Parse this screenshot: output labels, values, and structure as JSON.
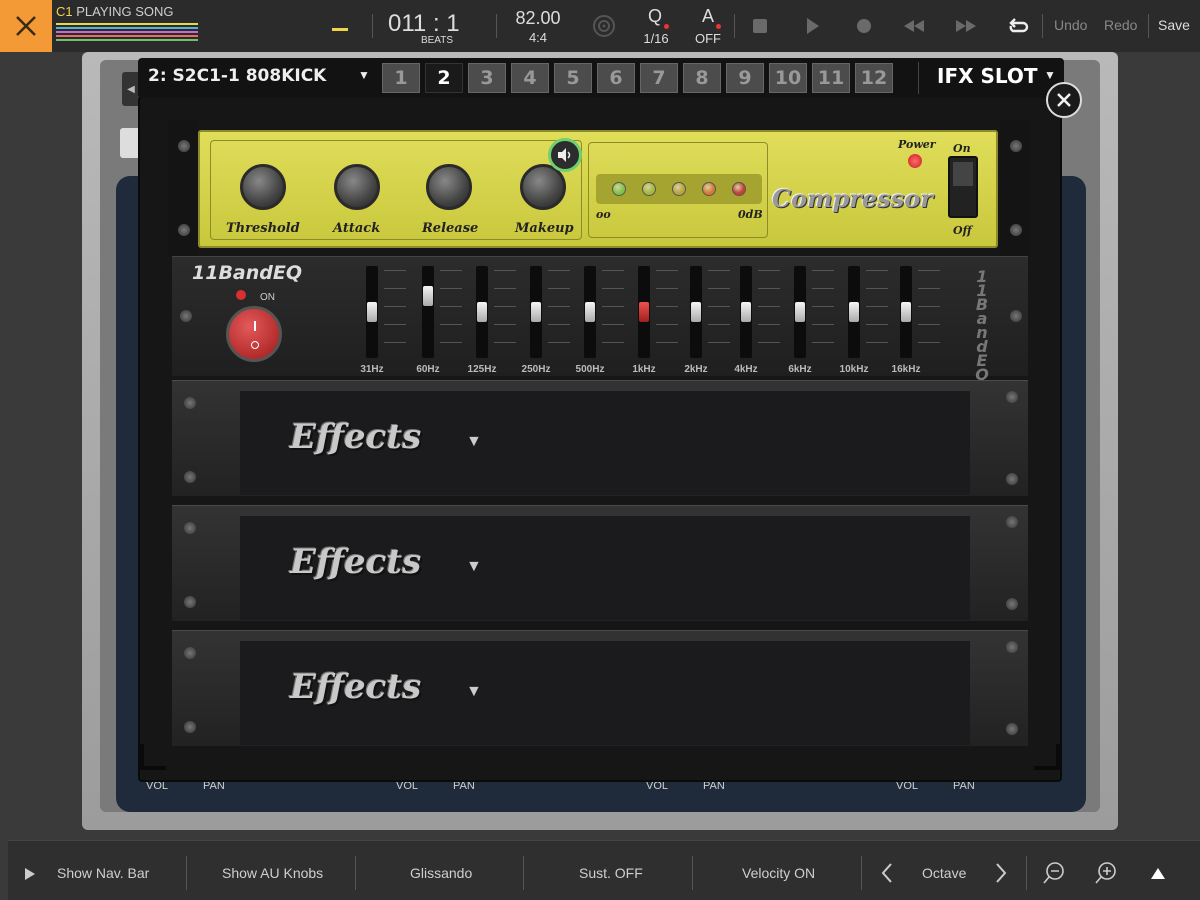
{
  "topbar": {
    "song_slot": "C1",
    "song_status": "PLAYING SONG",
    "position_bar": "011",
    "position_sep": ":",
    "position_beat": "1",
    "position_unit": "BEATS",
    "tempo": "82.00",
    "time_signature": "4:4",
    "quantize_label": "Q",
    "quantize_value": "1/16",
    "automation_label": "A",
    "automation_value": "OFF",
    "undo_label": "Undo",
    "redo_label": "Redo",
    "save_label": "Save",
    "track_colors": [
      "#e8d848",
      "#4fb4d6",
      "#c86ad0",
      "#e86b6b",
      "#74c06a"
    ]
  },
  "plugin": {
    "track_name": "2: S2C1-1 808KICK",
    "slots": [
      "1",
      "2",
      "3",
      "4",
      "5",
      "6",
      "7",
      "8",
      "9",
      "10",
      "11",
      "12"
    ],
    "active_slot": "2",
    "slot_type": "IFX SLOT"
  },
  "compressor": {
    "title": "Compressor",
    "knobs": [
      "Threshold",
      "Attack",
      "Release",
      "Makeup"
    ],
    "meter_min": "oo",
    "meter_max": "0dB",
    "power_label": "Power",
    "switch_on": "On",
    "switch_off": "Off",
    "led_colors": [
      "#7fc34a",
      "#a5b840",
      "#b8a440",
      "#d6783a",
      "#c8403a"
    ]
  },
  "eq": {
    "title": "11BandEQ",
    "side_title": "11 BandEQ",
    "on_label": "ON",
    "bands": [
      "31Hz",
      "60Hz",
      "125Hz",
      "250Hz",
      "500Hz",
      "1kHz",
      "2kHz",
      "4kHz",
      "6kHz",
      "10kHz",
      "16kHz"
    ],
    "band_levels": [
      0.5,
      0.72,
      0.5,
      0.5,
      0.5,
      0.5,
      0.5,
      0.5,
      0.5,
      0.5,
      0.5
    ]
  },
  "effects": [
    {
      "label": "Effects"
    },
    {
      "label": "Effects"
    },
    {
      "label": "Effects"
    }
  ],
  "mixer_labels": {
    "vol": "VOL",
    "pan": "PAN"
  },
  "bottombar": {
    "nav": "Show Nav. Bar",
    "au": "Show AU Knobs",
    "glissando": "Glissando",
    "sustain": "Sust. OFF",
    "velocity": "Velocity ON",
    "octave": "Octave"
  }
}
